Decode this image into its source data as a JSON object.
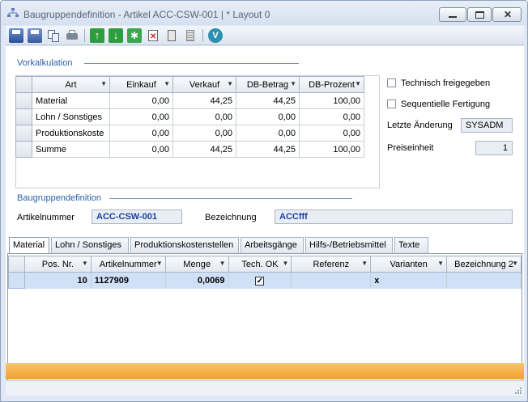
{
  "window": {
    "title": "Baugruppendefinition  -  Artikel ACC-CSW-001 | * Layout 0"
  },
  "toolbar": {
    "icons": [
      "save-icon",
      "save-close-icon",
      "copy-icon",
      "print-icon",
      "move-up-icon",
      "move-down-icon",
      "expand-icon",
      "delete-icon",
      "calculator-icon",
      "list-icon",
      "logo-icon"
    ]
  },
  "vorkalkulation": {
    "label": "Vorkalkulation",
    "columns": [
      "Art",
      "Einkauf",
      "Verkauf",
      "DB-Betrag",
      "DB-Prozent"
    ],
    "rows": [
      {
        "art": "Material",
        "einkauf": "0,00",
        "verkauf": "44,25",
        "db_betrag": "44,25",
        "db_prozent": "100,00"
      },
      {
        "art": "Lohn / Sonstiges",
        "einkauf": "0,00",
        "verkauf": "0,00",
        "db_betrag": "0,00",
        "db_prozent": "0,00"
      },
      {
        "art": "Produktionskoste",
        "einkauf": "0,00",
        "verkauf": "0,00",
        "db_betrag": "0,00",
        "db_prozent": "0,00"
      },
      {
        "art": "Summe",
        "einkauf": "0,00",
        "verkauf": "44,25",
        "db_betrag": "44,25",
        "db_prozent": "100,00"
      }
    ]
  },
  "options": {
    "technisch_label": "Technisch freigegeben",
    "sequentielle_label": "Sequentielle Fertigung",
    "letzte_aenderung_label": "Letzte Änderung",
    "letzte_aenderung_value": "SYSADM",
    "preiseinheit_label": "Preiseinheit",
    "preiseinheit_value": "1"
  },
  "baugruppe": {
    "label": "Baugruppendefinition",
    "artikelnummer_label": "Artikelnummer",
    "artikelnummer_value": "ACC-CSW-001",
    "bezeichnung_label": "Bezeichnung",
    "bezeichnung_value": "ACCfff"
  },
  "tabs": [
    "Material",
    "Lohn / Sonstiges",
    "Produktionskostenstellen",
    "Arbeitsgänge",
    "Hilfs-/Betriebsmittel",
    "Texte"
  ],
  "material": {
    "columns": [
      "Pos. Nr.",
      "Artikelnummer",
      "Menge",
      "Tech. OK",
      "Referenz",
      "Varianten",
      "Bezeichnung 2"
    ],
    "rows": [
      {
        "pos": "10",
        "artikelnummer": "1127909",
        "menge": "0,0069",
        "tech_ok": true,
        "referenz": "",
        "varianten": "x",
        "bezeichnung2": ""
      }
    ]
  }
}
